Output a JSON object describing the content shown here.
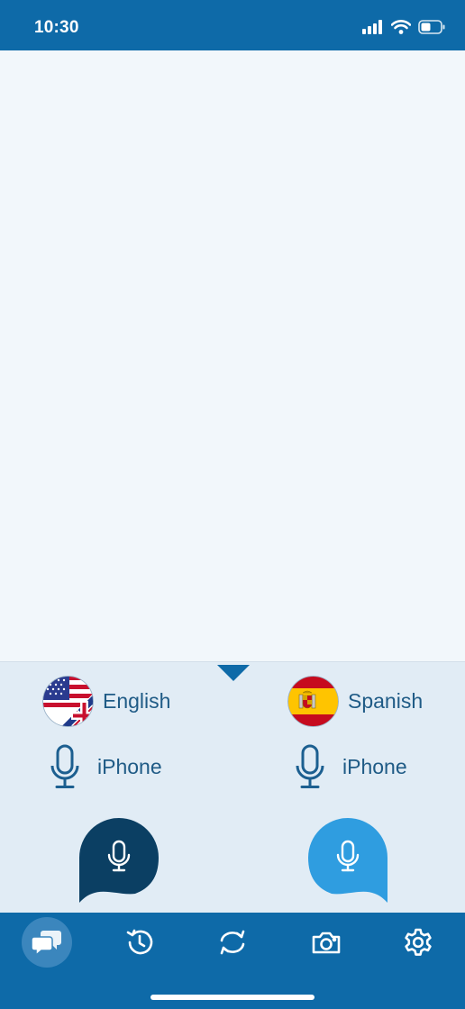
{
  "status_bar": {
    "time": "10:30",
    "icons": [
      "cellular-signal-icon",
      "wifi-icon",
      "battery-icon"
    ]
  },
  "languages": {
    "left": {
      "name": "English",
      "flag": "uk-us-flag-icon",
      "input_device": "iPhone"
    },
    "right": {
      "name": "Spanish",
      "flag": "spain-flag-icon",
      "input_device": "iPhone"
    }
  },
  "talk_buttons": {
    "left_color": "#0b3f63",
    "right_color": "#2f9de0"
  },
  "tab_bar": {
    "tabs": [
      "conversation-icon",
      "history-icon",
      "swap-icon",
      "camera-icon",
      "settings-icon"
    ],
    "active_index": 0
  },
  "colors": {
    "brand": "#0e6aa8",
    "panel": "#e1ecf5",
    "text_accent": "#1f5b86"
  }
}
